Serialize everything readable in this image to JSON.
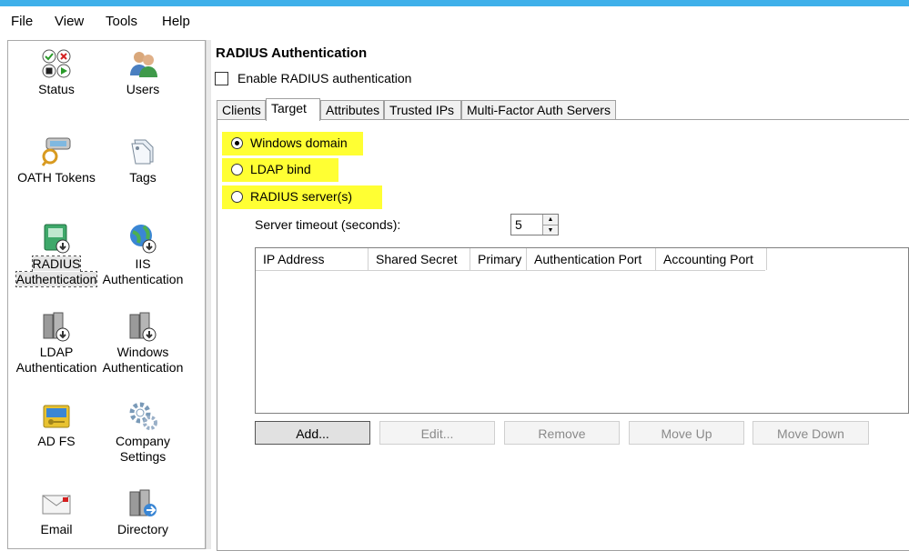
{
  "menu": {
    "items": [
      "File",
      "View",
      "Tools",
      "Help"
    ]
  },
  "nav": {
    "items": [
      {
        "label": "Status",
        "icon": "status-icon"
      },
      {
        "label": "Users",
        "icon": "users-icon"
      },
      {
        "label": "OATH Tokens",
        "icon": "oath-token-icon"
      },
      {
        "label": "Tags",
        "icon": "tags-icon"
      },
      {
        "label": "RADIUS\nAuthentication",
        "icon": "radius-auth-icon",
        "selected": true
      },
      {
        "label": "IIS\nAuthentication",
        "icon": "iis-auth-icon"
      },
      {
        "label": "LDAP\nAuthentication",
        "icon": "ldap-auth-icon"
      },
      {
        "label": "Windows\nAuthentication",
        "icon": "windows-auth-icon"
      },
      {
        "label": "AD FS",
        "icon": "adfs-icon"
      },
      {
        "label": "Company\nSettings",
        "icon": "company-settings-icon"
      },
      {
        "label": "Email",
        "icon": "email-icon"
      },
      {
        "label": "Directory",
        "icon": "directory-icon"
      }
    ]
  },
  "main": {
    "title": "RADIUS Authentication",
    "enable_label": "Enable RADIUS authentication",
    "enable_checked": false,
    "tabs": [
      "Clients",
      "Target",
      "Attributes",
      "Trusted IPs",
      "Multi-Factor Auth Servers"
    ],
    "active_tab": "Target",
    "target": {
      "options": [
        {
          "label": "Windows domain",
          "selected": true
        },
        {
          "label": "LDAP bind",
          "selected": false
        },
        {
          "label": "RADIUS server(s)",
          "selected": false
        }
      ],
      "timeout_label": "Server timeout (seconds):",
      "timeout_value": "5",
      "columns": [
        "IP Address",
        "Shared Secret",
        "Primary",
        "Authentication Port",
        "Accounting Port"
      ],
      "rows": [],
      "buttons": [
        {
          "label": "Add...",
          "enabled": true
        },
        {
          "label": "Edit...",
          "enabled": false
        },
        {
          "label": "Remove",
          "enabled": false
        },
        {
          "label": "Move Up",
          "enabled": false
        },
        {
          "label": "Move Down",
          "enabled": false
        }
      ]
    }
  },
  "colors": {
    "highlight": "#ffff33",
    "title_bar": "#3fb0ea"
  }
}
